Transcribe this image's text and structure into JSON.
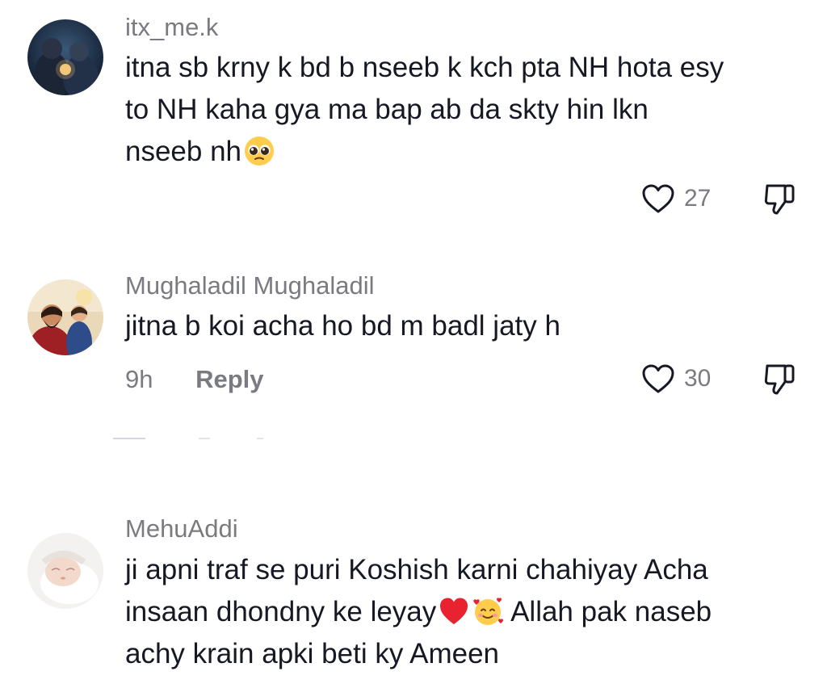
{
  "comments": [
    {
      "username": "itx_me.k",
      "text_lines": [
        "itna sb krny k bd b nseeb k kch pta NH hota esy",
        "to NH kaha gya ma bap ab da skty hin lkn",
        "nseeb nh"
      ],
      "trailing_emoji": "pleading-face-emoji",
      "like_count": "27"
    },
    {
      "username": "Mughaladil Mughaladil",
      "text_lines": [
        "jitna b koi acha ho bd m badl jaty h"
      ],
      "time": "9h",
      "reply_label": "Reply",
      "like_count": "30"
    },
    {
      "username": "MehuAddi",
      "text_lines": [
        "ji apni traf se puri Koshish karni chahiyay Acha",
        "insaan dhondny ke leyay",
        " Allah pak naseb",
        "achy krain apki beti ky Ameen"
      ],
      "inline_emojis": [
        "red-heart-emoji",
        "smiling-face-with-hearts-emoji"
      ]
    }
  ],
  "colors": {
    "text": "#161823",
    "muted": "#7a7b80",
    "background": "#ffffff"
  },
  "icons": {
    "like": "heart-outline-icon",
    "dislike": "thumbs-down-outline-icon"
  }
}
